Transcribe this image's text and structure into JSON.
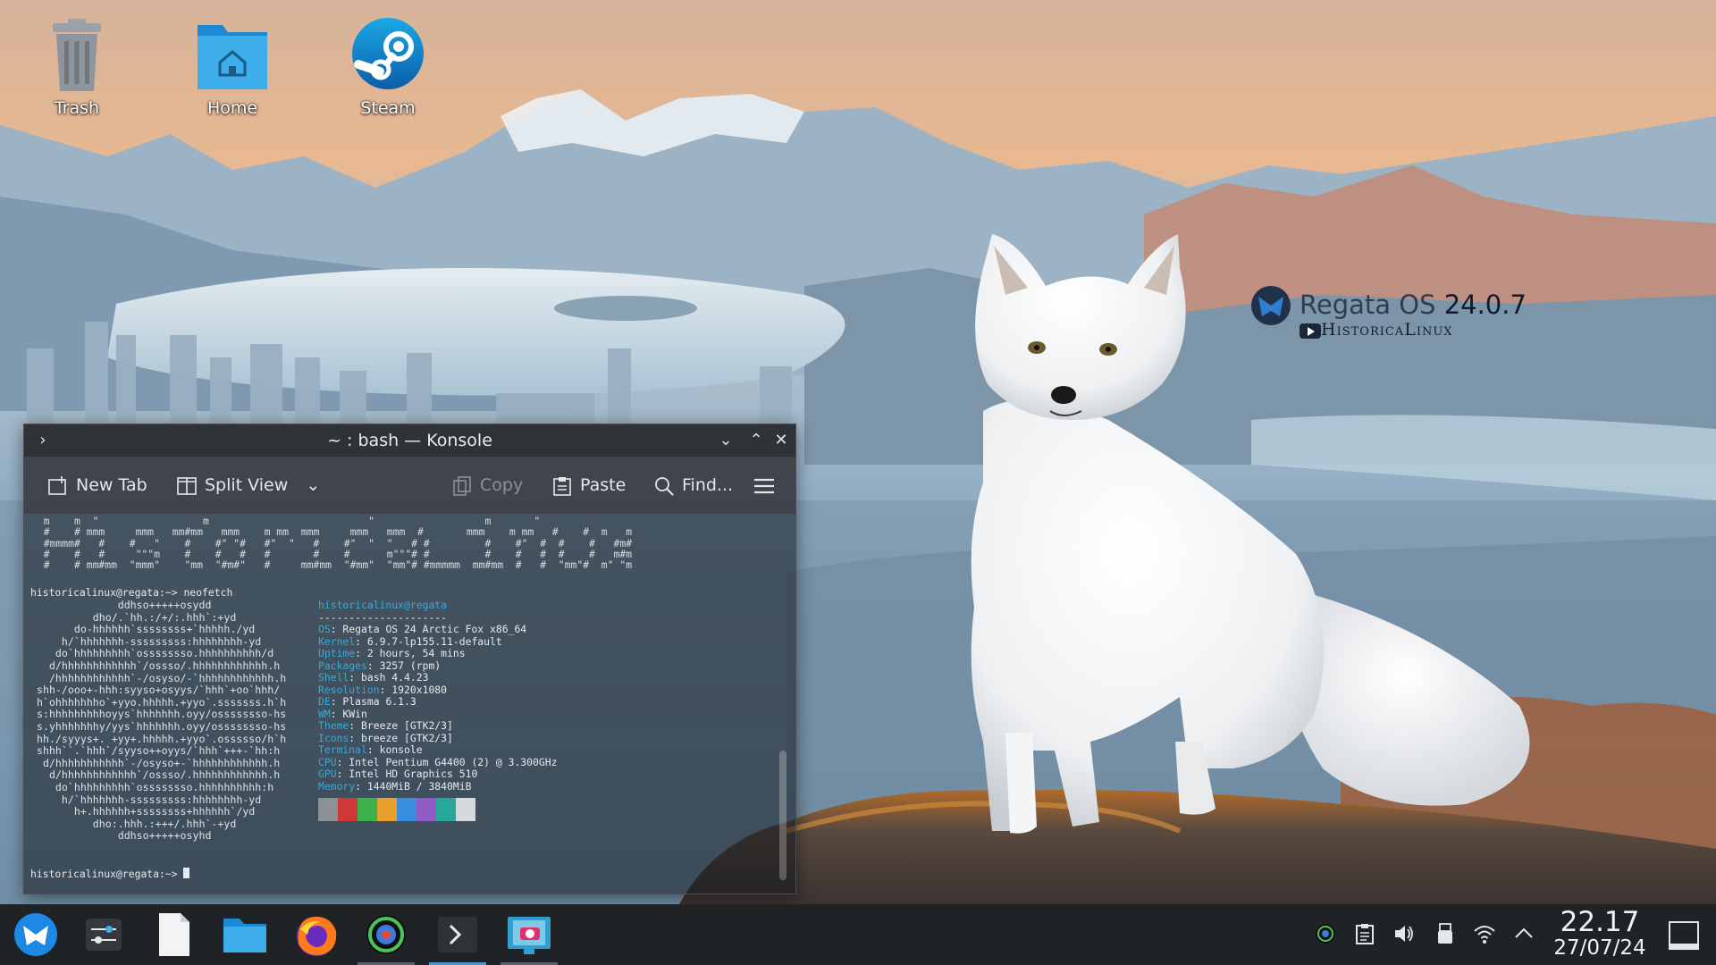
{
  "desktop": {
    "icons": [
      {
        "label": "Trash"
      },
      {
        "label": "Home"
      },
      {
        "label": "Steam"
      }
    ]
  },
  "watermark": {
    "brand": "Regata OS",
    "version": "24.0.7",
    "channel": "HistoricaLinux"
  },
  "konsole": {
    "title": "~ : bash — Konsole",
    "toolbar": {
      "new_tab": "New Tab",
      "split_view": "Split View",
      "copy": "Copy",
      "paste": "Paste",
      "find": "Find..."
    },
    "banner": "  m    m  \"                 m                          \"                  m       \"\n  #    # mmm     mmm   mm#mm   mmm    m mm  mmm     mmm   mmm  #       mmm    m mm   #    #  m   m\n  #mmmm#   #    #   \"    #    #\" \"#   #\"  \"   #    #\"  \"  \"   # #         #    #\"  #  #    #   #m#\n  #    #   #     \"\"\"m    #    #   #   #       #    #      m\"\"\"# #         #    #   #  #    #   m#m\n  #    # mm#mm  \"mmm\"    \"mm  \"#m#\"   #     mm#mm  \"#mm\"  \"mm\"# #mmmmm  mm#mm  #   #  \"mm\"#  m\" \"m",
    "prompt_cmd": "historicalinux@regata:~> neofetch",
    "logo": "              ddhso+++++osydd\n          dho/.`hh.:/+/:.hhh`:+yd\n       do-hhhhhh`ssssssss+`hhhhh./yd\n     h/`hhhhhhh-sssssssss:hhhhhhhh-yd\n    do`hhhhhhhhh`ossssssso.hhhhhhhhhh/d\n   d/hhhhhhhhhhhh`/ossso/.hhhhhhhhhhhh.h\n   /hhhhhhhhhhhh`-/osyso/-`hhhhhhhhhhhh.h\n shh-/ooo+-hhh:syyso+osyys/`hhh`+oo`hhh/\n h`ohhhhhhho`+yyo.hhhhh.+yyo`.sssssss.h`h\n s:hhhhhhhhhoyys`hhhhhhh.oyy/ossssssso-hs\n s.yhhhhhhhy/yys`hhhhhhh.oyy/ossssssso-hs\n hh./syyys+. +yy+.hhhhh.+yyo`.ossssso/h`h\n shhh``.`hhh`/syyso++oyys/`hhh`+++-`hh:h\n  d/hhhhhhhhhhh`-/osyso+-`hhhhhhhhhhhh.h\n   d/hhhhhhhhhhhh`/ossso/.hhhhhhhhhhhh.h\n    do`hhhhhhhhh`ossssssso.hhhhhhhhhh:h\n     h/`hhhhhhh-sssssssss:hhhhhhhh-yd\n       h+.hhhhhh+ssssssss+hhhhhh`/yd\n          dho:.hhh.:+++/.hhh`-+yd\n              ddhso+++++osyhd",
    "info_header": "historicalinux@regata",
    "info_sep": "---------------------",
    "info": [
      {
        "label": "OS",
        "value": ": Regata OS 24 Arctic Fox x86_64"
      },
      {
        "label": "Kernel",
        "value": ": 6.9.7-lp155.11-default"
      },
      {
        "label": "Uptime",
        "value": ": 2 hours, 54 mins"
      },
      {
        "label": "Packages",
        "value": ": 3257 (rpm)"
      },
      {
        "label": "Shell",
        "value": ": bash 4.4.23"
      },
      {
        "label": "Resolution",
        "value": ": 1920x1080"
      },
      {
        "label": "DE",
        "value": ": Plasma 6.1.3"
      },
      {
        "label": "WM",
        "value": ": KWin"
      },
      {
        "label": "Theme",
        "value": ": Breeze [GTK2/3]"
      },
      {
        "label": "Icons",
        "value": ": breeze [GTK2/3]"
      },
      {
        "label": "Terminal",
        "value": ": konsole"
      },
      {
        "label": "CPU",
        "value": ": Intel Pentium G4400 (2) @ 3.300GHz"
      },
      {
        "label": "GPU",
        "value": ": Intel HD Graphics 510"
      },
      {
        "label": "Memory",
        "value": ": 1440MiB / 3840MiB"
      }
    ],
    "swatch_colors": [
      "#8d9196",
      "#d03838",
      "#3bb34a",
      "#e8a02c",
      "#3a8ee0",
      "#8e5cc4",
      "#27a89a",
      "#d6d9dc"
    ],
    "prompt": "historicalinux@regata:~>"
  },
  "taskbar": {
    "clock_time": "22.17",
    "clock_date": "27/07/24"
  },
  "colors": {
    "accent": "#3a9bdc",
    "terminal_label": "#3aa8d8"
  }
}
